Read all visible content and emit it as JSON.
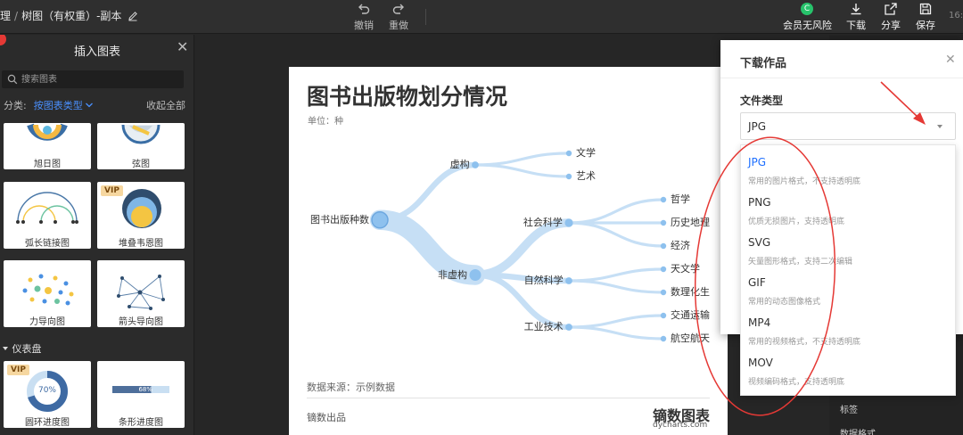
{
  "topbar": {
    "crumb_prev": "理",
    "crumb_current": "树图（有权重）-副本",
    "undo": "撤销",
    "redo": "重做",
    "vip_icon_letter": "C",
    "vip_text": "会员无风险",
    "download": "下载",
    "share": "分享",
    "save": "保存",
    "clock": "16:"
  },
  "left_panel": {
    "title": "插入图表",
    "search_placeholder": "搜索图表",
    "category_label": "分类:",
    "category_value": "按图表类型",
    "collapse_all": "收起全部",
    "cards": [
      {
        "label": "旭日图",
        "vip": false
      },
      {
        "label": "弦图",
        "vip": false
      },
      {
        "label": "弧长链接图",
        "vip": false
      },
      {
        "label": "堆叠韦恩图",
        "vip": true
      },
      {
        "label": "力导向图",
        "vip": false
      },
      {
        "label": "箭头导向图",
        "vip": false
      },
      {
        "label": "圆环进度图",
        "vip": true,
        "value": "70%",
        "progress": 0.7
      },
      {
        "label": "条形进度图",
        "vip": false,
        "value": "68%",
        "progress": 0.68
      }
    ],
    "vip_badge": "VIP",
    "section_dashboard": "仪表盘"
  },
  "chart": {
    "title": "图书出版物划分情况",
    "unit": "单位：种",
    "source": "数据来源：示例数据",
    "maker": "镝数出品",
    "brand": "镝数图表",
    "brand_url": "dycharts.com"
  },
  "chart_data": {
    "type": "tree",
    "root": "图书出版种数",
    "children": [
      {
        "name": "虚构",
        "children": [
          {
            "name": "文学"
          },
          {
            "name": "艺术"
          }
        ]
      },
      {
        "name": "非虚构",
        "children": [
          {
            "name": "社会科学",
            "children": [
              {
                "name": "哲学"
              },
              {
                "name": "历史地理"
              },
              {
                "name": "经济"
              }
            ]
          },
          {
            "name": "自然科学",
            "children": [
              {
                "name": "天文学"
              },
              {
                "name": "数理化生"
              }
            ]
          },
          {
            "name": "工业技术",
            "children": [
              {
                "name": "交通运输"
              },
              {
                "name": "航空航天"
              }
            ]
          }
        ]
      }
    ]
  },
  "right_strip": {
    "item1": "标签",
    "item2": "数据格式"
  },
  "download": {
    "title": "下载作品",
    "file_type_label": "文件类型",
    "selected": "JPG",
    "options": [
      {
        "name": "JPG",
        "desc": "常用的图片格式，不支持透明底"
      },
      {
        "name": "PNG",
        "desc": "优质无损图片，支持透明底"
      },
      {
        "name": "SVG",
        "desc": "矢量图形格式，支持二次编辑"
      },
      {
        "name": "GIF",
        "desc": "常用的动态图像格式"
      },
      {
        "name": "MP4",
        "desc": "常用的视频格式，不支持透明底"
      },
      {
        "name": "MOV",
        "desc": "视频编码格式，支持透明底"
      }
    ]
  },
  "colors": {
    "accent": "#1e6fff",
    "tree_link": "#c6dff5",
    "tree_node": "#8ec1ee",
    "annotation": "#e53935",
    "vip_green": "#27c36b"
  }
}
